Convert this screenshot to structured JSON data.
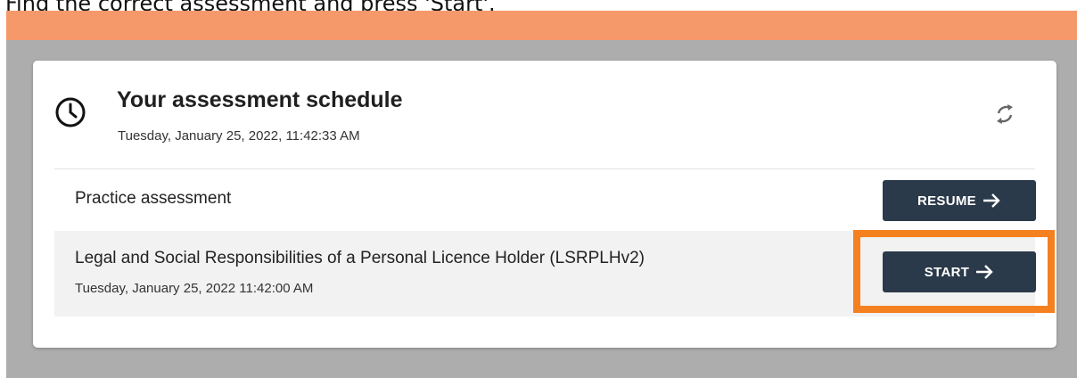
{
  "instruction": "Find the correct assessment and press 'Start'.",
  "card": {
    "title": "Your assessment schedule",
    "current_datetime": "Tuesday, January 25, 2022, 11:42:33 AM",
    "icons": {
      "header": "clock-icon",
      "refresh": "refresh-icon"
    }
  },
  "assessments": [
    {
      "name": "Practice assessment",
      "button_label": "RESUME"
    },
    {
      "name": "Legal and Social Responsibilities of a Personal Licence Holder (LSRPLHv2)",
      "scheduled": "Tuesday, January 25, 2022 11:42:00 AM",
      "button_label": "START"
    }
  ],
  "colors": {
    "banner": "#f5996b",
    "backdrop": "#adadad",
    "button": "#2b3a4a",
    "highlight": "#f5801f"
  }
}
